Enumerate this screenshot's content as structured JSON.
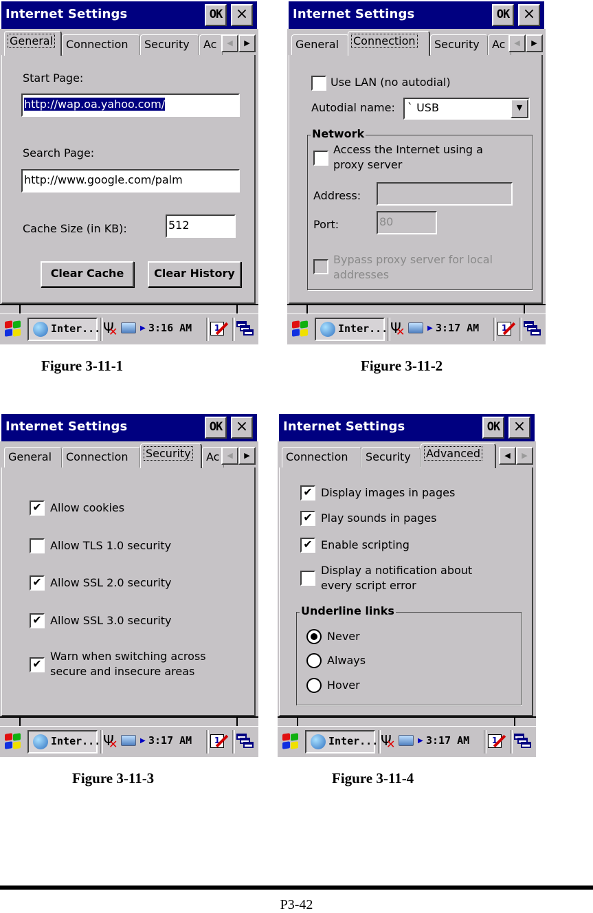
{
  "window": {
    "title": "Internet Settings",
    "ok_label": "OK",
    "close_label": "×"
  },
  "colors": {
    "titlebar": "#000080",
    "dialog_bg": "#c6c3c6",
    "selection": "#000080",
    "disabled_text": "#8a8a8a"
  },
  "taskbar": {
    "start_icon": "windows-flag-icon",
    "task_label": "Inter...",
    "tray_icons": [
      "antenna-no-signal-icon",
      "network-pc-icon",
      "tray-expand-arrow-icon"
    ],
    "times": [
      "3:16 AM",
      "3:17 AM",
      "3:17 AM",
      "3:17 AM"
    ],
    "input_panel_icon": "keyboard-pen-icon",
    "window_list_icon": "window-list-icon"
  },
  "screens": [
    {
      "caption": "Figure 3-11-1",
      "tabs": [
        "General",
        "Connection",
        "Security",
        "Ac"
      ],
      "active_tab": "General",
      "general": {
        "start_page_label": "Start Page:",
        "start_page_value": "http://wap.oa.yahoo.com/",
        "search_page_label": "Search Page:",
        "search_page_value": "http://www.google.com/palm",
        "cache_size_label": "Cache Size (in KB):",
        "cache_size_value": "512",
        "clear_cache_label": "Clear Cache",
        "clear_history_label": "Clear History"
      }
    },
    {
      "caption": "Figure 3-11-2",
      "tabs": [
        "General",
        "Connection",
        "Security",
        "Ac"
      ],
      "active_tab": "Connection",
      "connection": {
        "use_lan_label": "Use LAN (no autodial)",
        "use_lan_checked": false,
        "autodial_label": "Autodial name:",
        "autodial_value": "` USB",
        "network_group_title": "Network",
        "proxy_label_line1": "Access the Internet using a",
        "proxy_label_line2": "proxy server",
        "proxy_checked": false,
        "address_label": "Address:",
        "address_value": "",
        "port_label": "Port:",
        "port_value": "80",
        "bypass_label_line1": "Bypass proxy server for local",
        "bypass_label_line2": "addresses",
        "bypass_checked": false
      }
    },
    {
      "caption": "Figure 3-11-3",
      "tabs": [
        "General",
        "Connection",
        "Security",
        "Ac"
      ],
      "active_tab": "Security",
      "security": {
        "options": [
          {
            "label": "Allow cookies",
            "checked": true
          },
          {
            "label": "Allow TLS 1.0 security",
            "checked": false
          },
          {
            "label": "Allow SSL 2.0 security",
            "checked": true
          },
          {
            "label": "Allow SSL 3.0 security",
            "checked": true
          },
          {
            "label_line1": "Warn when switching across",
            "label_line2": "secure and insecure areas",
            "checked": true
          }
        ]
      }
    },
    {
      "caption": "Figure 3-11-4",
      "tabs": [
        "Connection",
        "Security",
        "Advanced"
      ],
      "active_tab": "Advanced",
      "advanced": {
        "options": [
          {
            "label": "Display images in pages",
            "checked": true
          },
          {
            "label": "Play sounds in pages",
            "checked": true
          },
          {
            "label": "Enable scripting",
            "checked": true
          },
          {
            "label_line1": "Display a notification about",
            "label_line2": "every script error",
            "checked": false
          }
        ],
        "underline_group_title": "Underline links",
        "underline_options": [
          "Never",
          "Always",
          "Hover"
        ],
        "underline_selected": "Never"
      }
    }
  ],
  "footer": {
    "page_number": "P3-42"
  }
}
